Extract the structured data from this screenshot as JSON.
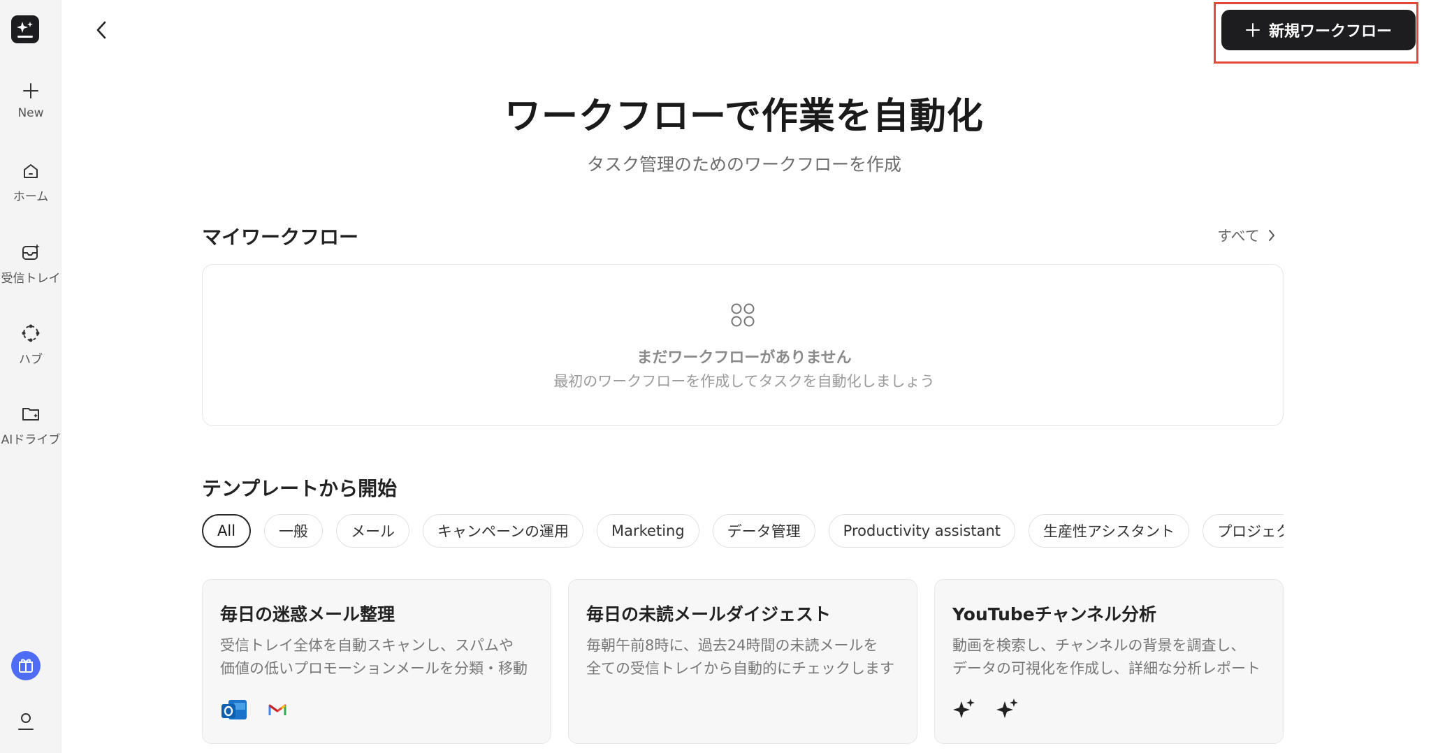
{
  "sidebar": {
    "items": [
      {
        "label": "New",
        "icon": "plus-icon"
      },
      {
        "label": "ホーム",
        "icon": "home-icon"
      },
      {
        "label": "受信トレイ",
        "icon": "inbox-icon"
      },
      {
        "label": "ハブ",
        "icon": "hub-icon"
      },
      {
        "label": "AIドライブ",
        "icon": "folder-icon"
      }
    ]
  },
  "header": {
    "new_workflow_label": "新規ワークフロー",
    "accent_highlight": "#e3483a",
    "button_color": "#1d1d1f"
  },
  "hero": {
    "title": "ワークフローで作業を自動化",
    "subtitle": "タスク管理のためのワークフローを作成"
  },
  "my_workflows": {
    "title": "マイワークフロー",
    "see_all": "すべて",
    "empty_title": "まだワークフローがありません",
    "empty_subtitle": "最初のワークフローを作成してタスクを自動化しましょう"
  },
  "templates": {
    "title": "テンプレートから開始",
    "chips": [
      "All",
      "一般",
      "メール",
      "キャンペーンの運用",
      "Marketing",
      "データ管理",
      "Productivity assistant",
      "生産性アシスタント",
      "プロジェクト"
    ],
    "selected_chip": "All",
    "cards": [
      {
        "title": "毎日の迷惑メール整理",
        "desc_line1": "受信トレイ全体を自動スキャンし、スパムや",
        "desc_line2": "価値の低いプロモーションメールを分類・移動",
        "icons": [
          "outlook-icon",
          "gmail-icon"
        ]
      },
      {
        "title": "毎日の未読メールダイジェスト",
        "desc_line1": "毎朝午前8時に、過去24時間の未読メールを",
        "desc_line2": "全ての受信トレイから自動的にチェックします",
        "icons": []
      },
      {
        "title": "YouTubeチャンネル分析",
        "desc_line1": "動画を検索し、チャンネルの背景を調査し、",
        "desc_line2": "データの可視化を作成し、詳細な分析レポート",
        "icons": [
          "sparkle-icon",
          "sparkle-icon"
        ]
      }
    ]
  }
}
